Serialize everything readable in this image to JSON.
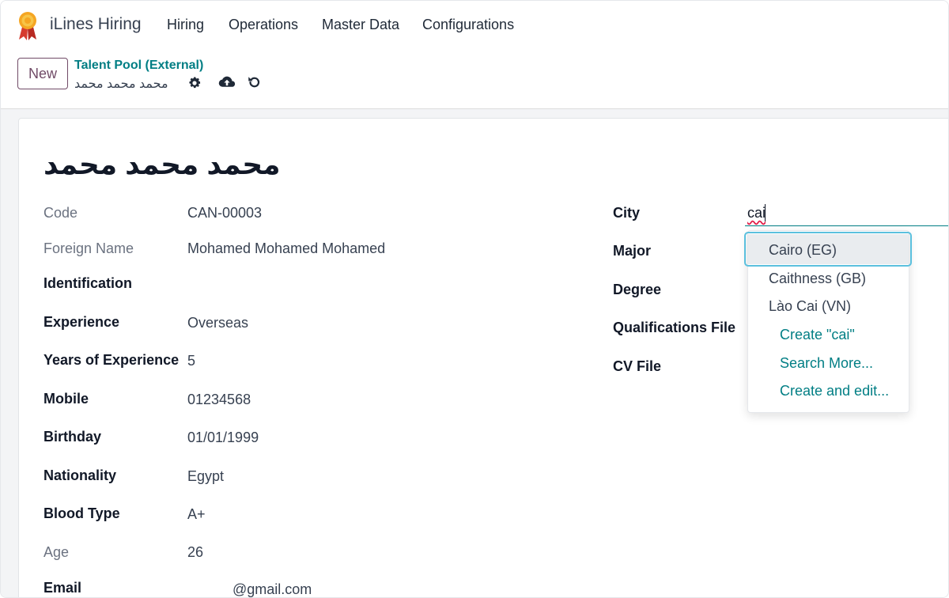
{
  "app": {
    "name": "iLines Hiring"
  },
  "menu": [
    "Hiring",
    "Operations",
    "Master Data",
    "Configurations"
  ],
  "control_panel": {
    "new_label": "New",
    "breadcrumb": "Talent Pool (External)",
    "record_name": "محمد محمد محمد"
  },
  "form": {
    "title": "محمد محمد محمد",
    "left": [
      {
        "label": "Code",
        "value": "CAN-00003"
      },
      {
        "label": "Foreign Name",
        "value": "Mohamed Mohamed Mohamed"
      },
      {
        "label": "Identification",
        "value": ""
      },
      {
        "label": "Experience",
        "value": "Overseas"
      },
      {
        "label": "Years of Experience",
        "value": "5"
      },
      {
        "label": "Mobile",
        "value": "01234568"
      },
      {
        "label": "Birthday",
        "value": "01/01/1999"
      },
      {
        "label": "Nationality",
        "value": "Egypt"
      },
      {
        "label": "Blood Type",
        "value": "A+"
      },
      {
        "label": "Age",
        "value": "26"
      },
      {
        "label": "Email",
        "value": "@gmail.com"
      }
    ],
    "right": [
      {
        "label": "City",
        "value": "cai"
      },
      {
        "label": "Major",
        "value": ""
      },
      {
        "label": "Degree",
        "value": ""
      },
      {
        "label": "Qualifications File",
        "value": ""
      },
      {
        "label": "CV File",
        "value": ""
      }
    ]
  },
  "dropdown": {
    "options": [
      "Cairo (EG)",
      "Caithness (GB)",
      "Lào Cai (VN)"
    ],
    "selected": "Cairo (EG)",
    "actions": [
      "Create \"cai\"",
      "Search More...",
      "Create and edit..."
    ]
  },
  "colors": {
    "brand": "#714b67",
    "accent": "#017e84",
    "focus": "#5bc0de"
  },
  "icons": [
    "ribbon-logo-icon",
    "gear-icon",
    "cloud-upload-icon",
    "undo-icon"
  ]
}
